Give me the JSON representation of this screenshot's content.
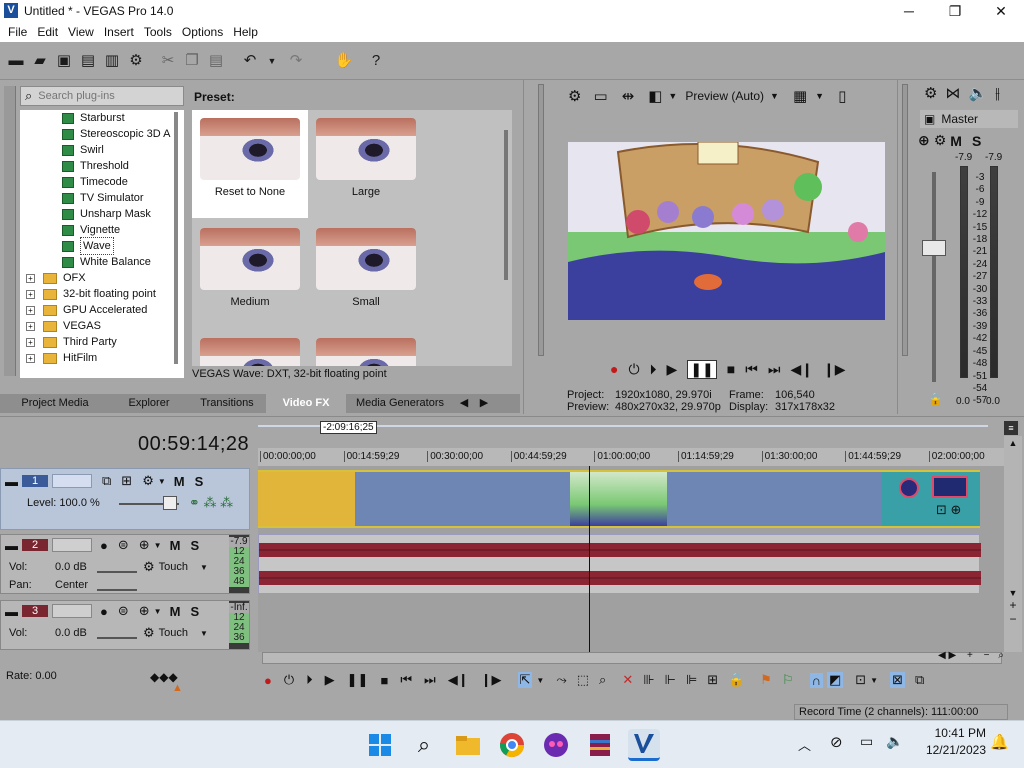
{
  "window": {
    "title": "Untitled * - VEGAS Pro 14.0",
    "logo": "V",
    "min": "─",
    "max": "❐",
    "close": "✕"
  },
  "menu": [
    "File",
    "Edit",
    "View",
    "Insert",
    "Tools",
    "Options",
    "Help"
  ],
  "fx": {
    "search_placeholder": "Search plug-ins",
    "tree": [
      "Starburst",
      "Stereoscopic 3D A",
      "Swirl",
      "Threshold",
      "Timecode",
      "TV Simulator",
      "Unsharp Mask",
      "Vignette",
      "Wave",
      "White Balance"
    ],
    "folders": [
      "OFX",
      "32-bit floating point",
      "GPU Accelerated",
      "VEGAS",
      "Third Party",
      "HitFilm"
    ],
    "selected": "Wave",
    "preset_label": "Preset:",
    "presets": [
      "Reset to None",
      "Large",
      "Medium",
      "Small"
    ],
    "status": "VEGAS Wave: DXT, 32-bit floating point",
    "tabs": [
      "Project Media",
      "Explorer",
      "Transitions",
      "Video FX",
      "Media Generators"
    ],
    "active_tab": "Video FX"
  },
  "preview": {
    "mode": "Preview (Auto)",
    "project_label": "Project:",
    "project_value": "1920x1080, 29.970i",
    "preview_label": "Preview:",
    "preview_value": "480x270x32, 29.970p",
    "frame_label": "Frame:",
    "frame_value": "106,540",
    "display_label": "Display:",
    "display_value": "317x178x32"
  },
  "master": {
    "label": "Master",
    "m": "M",
    "s": "S",
    "peak_l": "-7.9",
    "peak_r": "-7.9",
    "scale": [
      "3",
      "6",
      "9",
      "12",
      "15",
      "18",
      "21",
      "24",
      "27",
      "30",
      "33",
      "36",
      "39",
      "42",
      "45",
      "48",
      "51",
      "54",
      "57"
    ],
    "val_l": "0.0",
    "val_r": "0.0"
  },
  "timeline": {
    "timecode": "00:59:14;28",
    "marker": "-2:09:16;25",
    "ruler": [
      "00:00:00;00",
      "00:14:59;29",
      "00:30:00;00",
      "00:44:59;29",
      "01:00:00;00",
      "01:14:59;29",
      "01:30:00;00",
      "01:44:59;29",
      "02:00:00;00"
    ],
    "track1": {
      "num": "1",
      "level": "Level: 100.0 %",
      "m": "M",
      "s": "S"
    },
    "track2": {
      "num": "2",
      "vol_label": "Vol:",
      "vol": "0.0 dB",
      "pan_label": "Pan:",
      "pan": "Center",
      "touch": "Touch",
      "m": "M",
      "s": "S",
      "peak": "-7.9",
      "scale": [
        "12",
        "24",
        "36",
        "48"
      ]
    },
    "track3": {
      "num": "3",
      "vol_label": "Vol:",
      "vol": "0.0 dB",
      "touch": "Touch",
      "m": "M",
      "s": "S",
      "peak": "-Inf.",
      "scale": [
        "12",
        "24",
        "36"
      ]
    },
    "rate": "Rate: 0.00",
    "record_time": "Record Time (2 channels): 111:00:00"
  },
  "taskbar": {
    "time": "10:41 PM",
    "date": "12/21/2023"
  },
  "colors": {
    "accent": "#1a4f9c",
    "audio_wave": "#8b2533",
    "clip_video": "#6e86b4",
    "clip_yellow": "#e0b53a"
  }
}
